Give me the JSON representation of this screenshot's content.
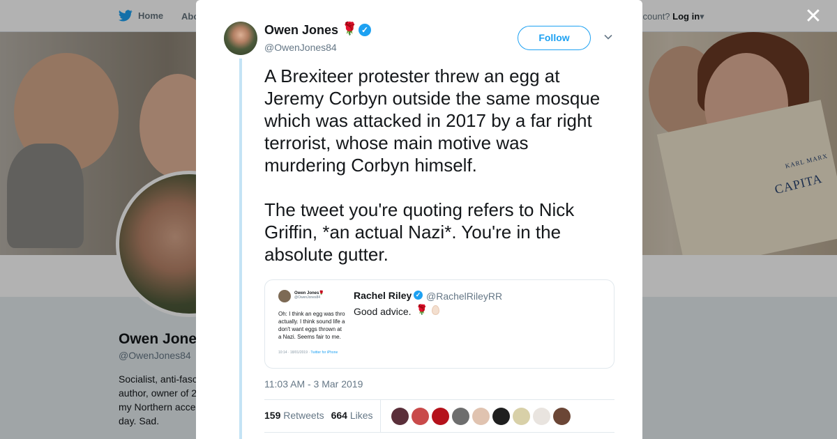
{
  "background": {
    "nav": {
      "home": "Home",
      "about": "Abo",
      "login_prompt": "ccount?",
      "login": "Log in"
    },
    "banner": {
      "book_author": "KARL MARX",
      "book_title": "CAPITA"
    },
    "profile": {
      "name": "Owen Jone",
      "handle": "@OwenJones84",
      "bio": "Socialist, anti-fasc author, owner of 2 my Northern acce day. Sad."
    }
  },
  "modal": {
    "close_icon": "close-icon",
    "author": {
      "name": "Owen Jones",
      "emoji": "🌹",
      "handle": "@OwenJones84"
    },
    "follow_label": "Follow",
    "tweet_text": "A Brexiteer protester threw an egg at Jeremy Corbyn outside the same mosque which was attacked in 2017 by a far right terrorist, whose main motive was murdering Corbyn himself.\n\nThe tweet you're quoting refers to Nick Griffin, *an actual Nazi*. You're in the absolute gutter.",
    "quote": {
      "thumb_name": "Owen Jones🌹",
      "thumb_handle": "@OwenJones84",
      "thumb_text": "Oh: I think an egg was thro\nactually. I think sound life a\ndon't want eggs thrown at\na Nazi. Seems fair to me.",
      "thumb_meta": "10:14 · 18/01/2019 · ",
      "thumb_source": "Twitter for iPhone",
      "name": "Rachel Riley",
      "handle": "@RachelRileyRR",
      "text": "Good advice.",
      "emoji": "🌹"
    },
    "timestamp": "11:03 AM - 3 Mar 2019",
    "stats": {
      "retweets_count": "159",
      "retweets_label": "Retweets",
      "likes_count": "664",
      "likes_label": "Likes"
    },
    "likers_colors": [
      "#5a2f3a",
      "#c94a4a",
      "#b5121b",
      "#6e6e6e",
      "#e0c3b0",
      "#1f1f1f",
      "#d8d0a8",
      "#e9e4df",
      "#6b4636"
    ]
  }
}
